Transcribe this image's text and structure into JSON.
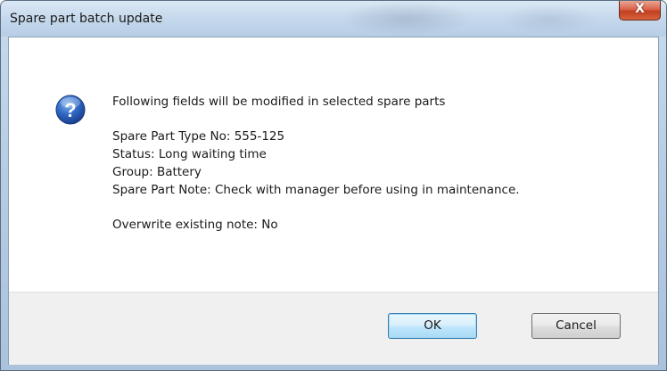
{
  "window": {
    "title": "Spare part batch update",
    "close_label": "X"
  },
  "message": {
    "heading": "Following fields will be modified in selected spare parts",
    "fields": [
      "Spare Part Type No: 555-125",
      "Status: Long waiting time",
      "Group: Battery",
      "Spare Part Note: Check with manager before using in maintenance."
    ],
    "overwrite": "Overwrite existing note: No",
    "icon": "question-icon"
  },
  "buttons": {
    "ok_label": "OK",
    "cancel_label": "Cancel"
  },
  "colors": {
    "icon_blue": "#2a5fb4",
    "close_red": "#c2401f",
    "focus_blue": "#3c7fb1"
  }
}
